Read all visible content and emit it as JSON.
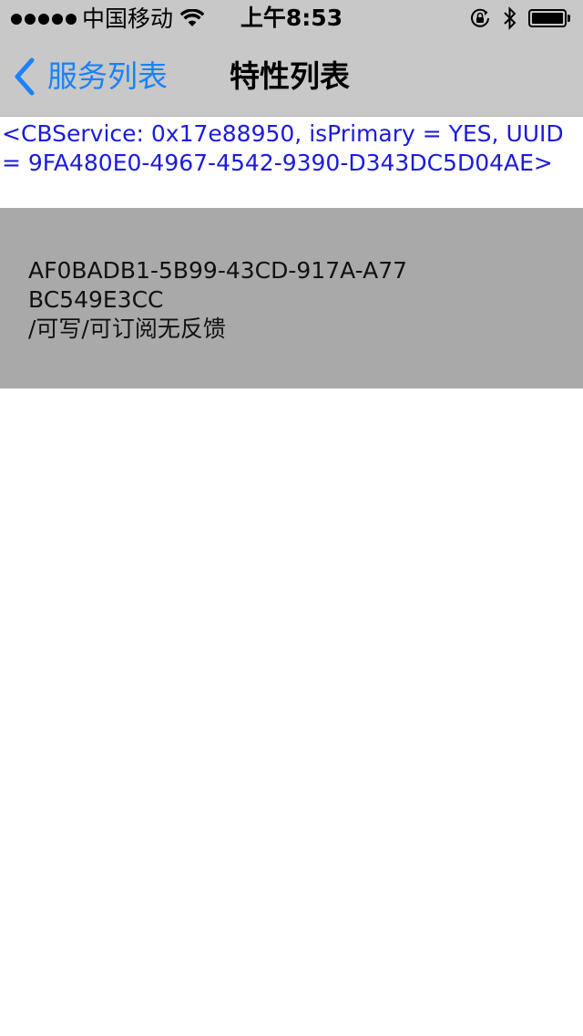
{
  "status_bar": {
    "signal_bars": 5,
    "carrier": "中国移动",
    "time": "上午8:53",
    "battery_level": 1.0
  },
  "nav": {
    "back_label": "服务列表",
    "title": "特性列表"
  },
  "service": {
    "description": "<CBService: 0x17e88950, isPrimary = YES, UUID = 9FA480E0-4967-4542-9390-D343DC5D04AE>"
  },
  "characteristics": [
    {
      "uuid": "AF0BADB1-5B99-43CD-917A-A77BC549E3CC",
      "properties": "/可写/可订阅无反馈"
    }
  ],
  "colors": {
    "nav_bar_bg": "#c8c8c8",
    "tint": "#1a82fb",
    "service_text": "#1b1bde",
    "row_bg": "#a9a9a9"
  }
}
